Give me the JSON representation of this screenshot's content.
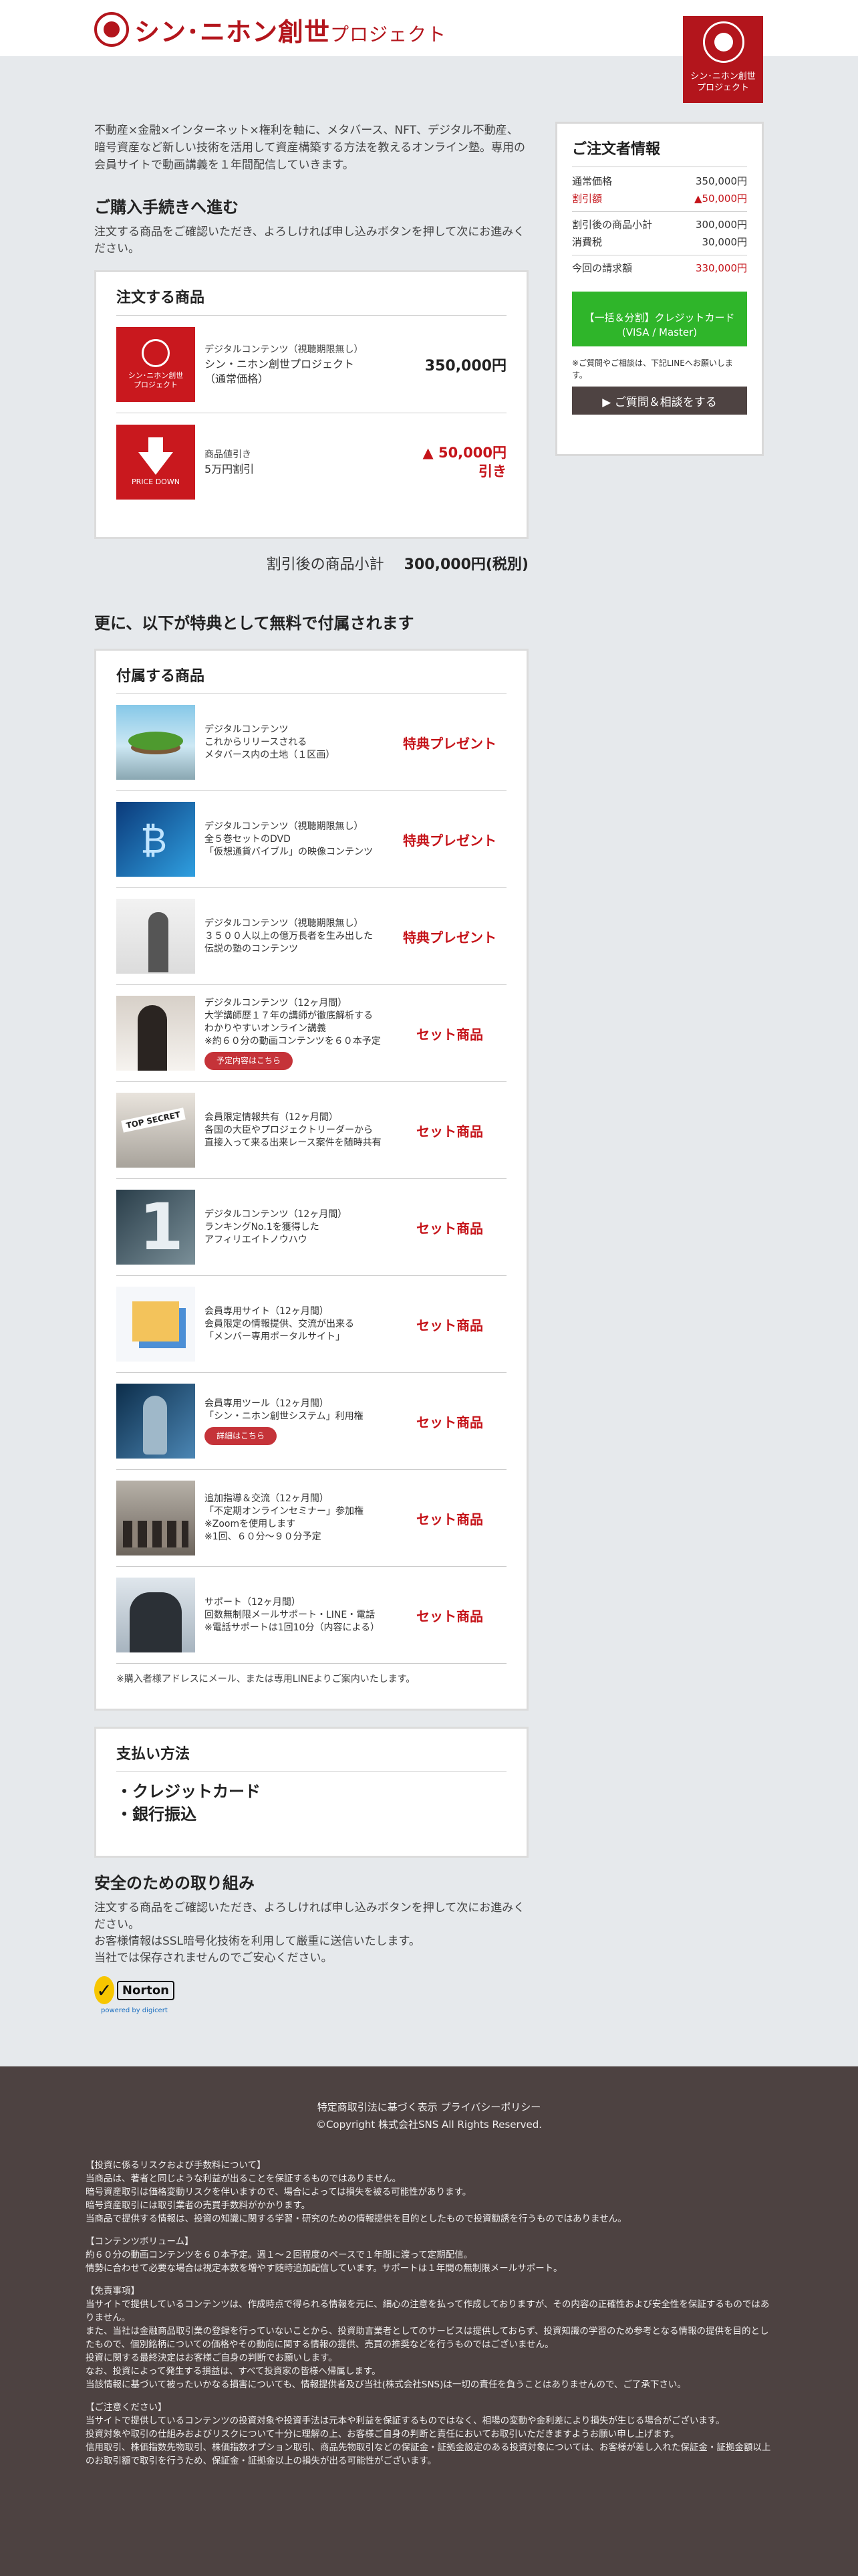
{
  "header": {
    "logo_text": "シン･ニホン創世",
    "logo_suffix": "プロジェクト",
    "badge_line1": "シン･ニホン創世",
    "badge_line2": "プロジェクト"
  },
  "intro": "不動産×金融×インターネット×権利を軸に、メタバース、NFT、デジタル不動産、暗号資産など新しい技術を活用して資産構築する方法を教えるオンライン塾。専用の会員サイトで動画講義を１年間配信していきます。",
  "purchase": {
    "heading": "ご購入手続きへ進む",
    "desc": "注文する商品をご確認いただき、よろしければ申し込みボタンを押して次にお進みください。"
  },
  "order": {
    "title": "注文する商品",
    "items": [
      {
        "thumb_line1": "シン･ニホン創世",
        "thumb_line2": "プロジェクト",
        "line1": "デジタルコンテンツ（視聴期限無し）",
        "line2": "シン・ニホン創世プロジェクト",
        "line3": "（通常価格）",
        "price": "350,000円"
      },
      {
        "thumb_label": "PRICE DOWN",
        "line1": "商品値引き",
        "line2": "5万円割引",
        "price": "▲ 50,000円引き"
      }
    ],
    "subtotal_label": "割引後の商品小計",
    "subtotal_value": "300,000円(税別)"
  },
  "bonus": {
    "heading": "更に、以下が特典として無料で付属されます",
    "title": "付属する商品",
    "items": [
      {
        "lines": [
          "デジタルコンテンツ",
          "これからリリースされる",
          "メタバース内の土地（１区画）"
        ],
        "label": "特典プレゼント"
      },
      {
        "lines": [
          "デジタルコンテンツ（視聴期限無し）",
          "全５巻セットのDVD",
          "「仮想通貨バイブル」の映像コンテンツ"
        ],
        "label": "特典プレゼント"
      },
      {
        "lines": [
          "デジタルコンテンツ（視聴期限無し）",
          "３５００人以上の億万長者を生み出した",
          "伝説の塾のコンテンツ"
        ],
        "label": "特典プレゼント"
      },
      {
        "lines": [
          "デジタルコンテンツ（12ヶ月間）",
          "大学講師歴１７年の講師が徹底解析する",
          "わかりやすいオンライン講義",
          "※約６０分の動画コンテンツを６０本予定"
        ],
        "button": "予定内容はこちら",
        "label": "セット商品"
      },
      {
        "lines": [
          "会員限定情報共有（12ヶ月間）",
          "各国の大臣やプロジェクトリーダーから",
          "直接入って来る出来レース案件を随時共有"
        ],
        "label": "セット商品"
      },
      {
        "lines": [
          "デジタルコンテンツ（12ヶ月間）",
          "ランキングNo.1を獲得した",
          "アフィリエイトノウハウ"
        ],
        "label": "セット商品"
      },
      {
        "lines": [
          "会員専用サイト（12ヶ月間）",
          "会員限定の情報提供、交流が出来る",
          "「メンバー専用ポータルサイト」"
        ],
        "label": "セット商品"
      },
      {
        "lines": [
          "会員専用ツール（12ヶ月間）",
          "「シン・ニホン創世システム」利用権"
        ],
        "button": "詳細はこちら",
        "label": "セット商品"
      },
      {
        "lines": [
          "追加指導＆交流（12ヶ月間）",
          "「不定期オンラインセミナー」参加権",
          "※Zoomを使用します",
          "※1回、６０分〜９０分予定"
        ],
        "label": "セット商品"
      },
      {
        "lines": [
          "サポート（12ヶ月間）",
          "回数無制限メールサポート・LINE・電話",
          "※電話サポートは1回10分（内容による）"
        ],
        "label": "セット商品"
      }
    ],
    "note": "※購入者様アドレスにメール、または専用LINEよりご案内いたします。"
  },
  "payment": {
    "title": "支払い方法",
    "methods": [
      "・クレジットカード",
      "・銀行振込"
    ]
  },
  "safety": {
    "heading": "安全のための取り組み",
    "line1": "注文する商品をご確認いただき、よろしければ申し込みボタンを押して次にお進みください。",
    "line2": "お客様情報はSSL暗号化技術を利用して厳重に送信いたします。",
    "line3": "当社では保存されませんのでご安心ください。",
    "norton_word": "Norton",
    "norton_sub": "powered by digicert"
  },
  "sidebar": {
    "title": "ご注文者情報",
    "rows": [
      {
        "label": "通常価格",
        "value": "350,000円"
      },
      {
        "label": "割引額",
        "value": "▲50,000円"
      },
      {
        "label": "割引後の商品小計",
        "value": "300,000円"
      },
      {
        "label": "消費税",
        "value": "30,000円"
      },
      {
        "label": "今回の請求額",
        "value": "330,000円"
      }
    ],
    "pay_button_line1": "【一括＆分割】クレジットカード",
    "pay_button_line2": "(VISA / Master)",
    "note": "※ご質問やご相談は、下記LINEへお願いします。",
    "ask_button": "▶ ご質問＆相談をする"
  },
  "footer": {
    "links": "特定商取引法に基づく表示 プライバシーポリシー",
    "copyright": "©Copyright 株式会社SNS All Rights Reserved.",
    "sections": [
      {
        "title": "【投資に係るリスクおよび手数料について】",
        "lines": [
          "当商品は、著者と同じような利益が出ることを保証するものではありません。",
          "暗号資産取引は価格変動リスクを伴いますので、場合によっては損失を被る可能性があります。",
          "暗号資産取引には取引業者の売買手数料がかかります。",
          "当商品で提供する情報は、投資の知識に関する学習・研究のための情報提供を目的としたもので投資勧誘を行うものではありません。"
        ]
      },
      {
        "title": "【コンテンツボリューム】",
        "lines": [
          "約６０分の動画コンテンツを６０本予定。週１〜２回程度のペースで１年間に渡って定期配信。",
          "情勢に合わせて必要な場合は視定本数を増やす随時追加配信しています。サポートは１年間の無制限メールサポート。"
        ]
      },
      {
        "title": "【免責事項】",
        "lines": [
          "当サイトで提供しているコンテンツは、作成時点で得られる情報を元に、細心の注意を払って作成しておりますが、その内容の正確性および安全性を保証するものではありません。",
          "また、当社は金融商品取引業の登録を行っていないことから、投資助言業者としてのサービスは提供しておらず、投資知識の学習のため参考となる情報の提供を目的としたもので、個別銘柄についての価格やその動向に関する情報の提供、売買の推奨などを行うものではございません。",
          "投資に関する最終決定はお客様ご自身の判断でお願いします。",
          "なお、投資によって発生する損益は、すべて投資家の皆様へ帰属します。",
          "当該情報に基づいて被ったいかなる損害についても、情報提供者及び当社(株式会社SNS)は一切の責任を負うことはありませんので、ご了承下さい。"
        ]
      },
      {
        "title": "【ご注意ください】",
        "lines": [
          "当サイトで提供しているコンテンツの投資対象や投資手法は元本や利益を保証するものではなく、相場の変動や金利差により損失が生じる場合がございます。",
          "投資対象や取引の仕組みおよびリスクについて十分に理解の上、お客様ご自身の判断と責任においてお取引いただきますようお願い申し上げます。",
          "信用取引、株価指数先物取引、株価指数オプション取引、商品先物取引などの保証金・証拠金設定のある投資対象については、お客様が差し入れた保証金・証拠金額以上のお取引額で取引を行うため、保証金・証拠金以上の損失が出る可能性がございます。"
        ]
      }
    ]
  }
}
